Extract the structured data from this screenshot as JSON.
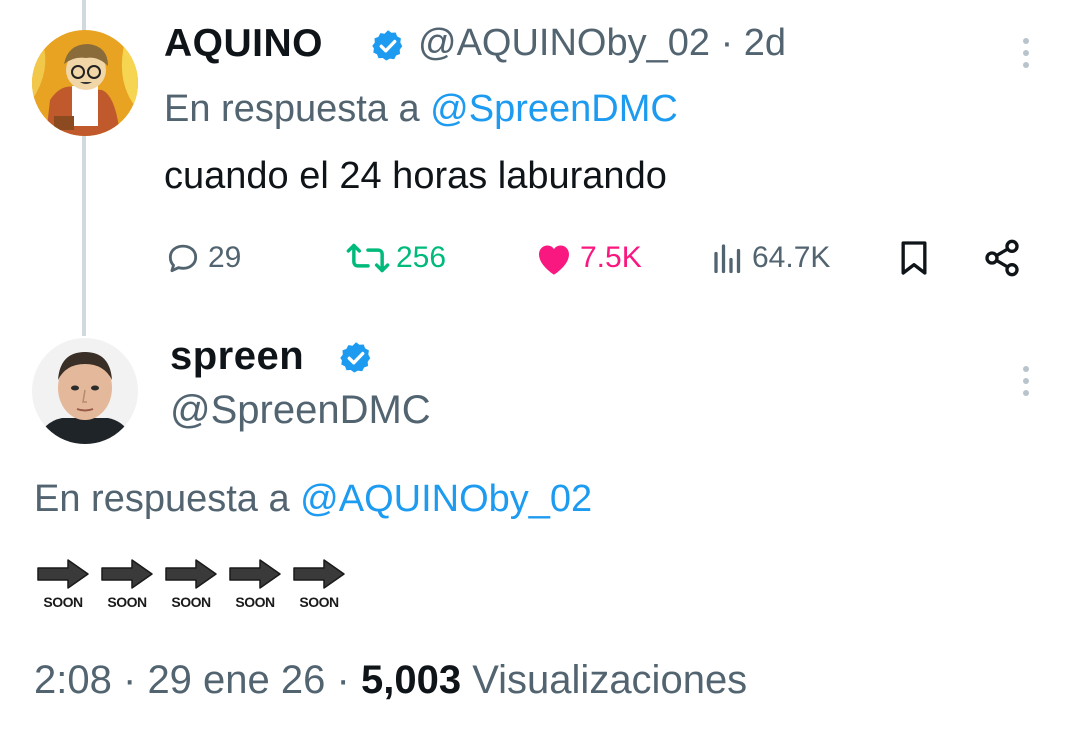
{
  "thread": {
    "reply_tweet": {
      "author_name": "AQUINO",
      "author_handle": "@AQUINOby_02",
      "separator": "·",
      "time_ago": "2d",
      "reply_prefix": "En respuesta a",
      "reply_target": "@SpreenDMC",
      "text": "cuando el 24 horas laburando",
      "actions": {
        "replies": "29",
        "retweets": "256",
        "likes": "7.5K",
        "views": "64.7K"
      },
      "colors": {
        "retweet": "#00ba7c",
        "like": "#f91880",
        "verified": "#1d9bf0"
      }
    },
    "main_tweet": {
      "author_name": "spreen",
      "author_handle": "@SpreenDMC",
      "reply_prefix": "En respuesta a",
      "reply_target": "@AQUINOby_02",
      "soon_label": "SOON",
      "soon_count": 5,
      "time": "2:08",
      "date": "29 ene 26",
      "separator": "·",
      "view_count": "5,003",
      "views_label": "Visualizaciones"
    }
  },
  "icons": [
    "more-icon",
    "verified-badge-icon",
    "reply-icon",
    "retweet-icon",
    "like-icon",
    "views-icon",
    "bookmark-icon",
    "share-icon",
    "soon-arrow-icon"
  ]
}
